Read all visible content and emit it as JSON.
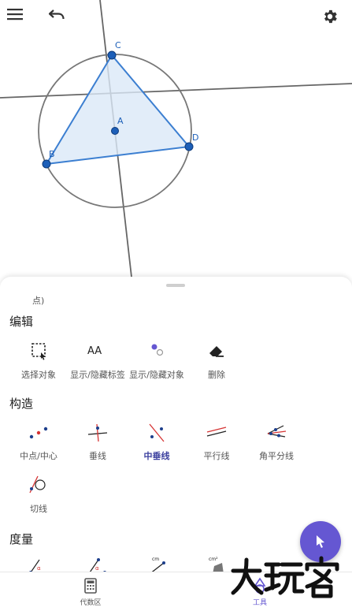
{
  "graph": {
    "point_labels": {
      "A": "A",
      "B": "B",
      "C": "C",
      "D": "D"
    }
  },
  "sheet": {
    "partial_label": "点)",
    "sections": {
      "edit": {
        "title": "编辑",
        "tools": [
          "选择对象",
          "显示/隐藏标签",
          "显示/隐藏对象",
          "删除"
        ]
      },
      "construct": {
        "title": "构造",
        "tools": [
          "中点/中心",
          "垂线",
          "中垂线",
          "平行线",
          "角平分线",
          "切线"
        ]
      },
      "measure": {
        "title": "度量",
        "icon_texts": {
          "angle_a": "α",
          "angle_b": "α",
          "cm": "cm",
          "cm2": "cm²"
        }
      }
    },
    "icon_texts": {
      "aa": "AA"
    }
  },
  "nav": {
    "algebra": "代数区",
    "tools": "工具"
  },
  "colors": {
    "accent": "#6557d2",
    "segment": "#3c7fd1",
    "triangle_fill": "#dbe8f7",
    "point": "#1d5fb8",
    "line": "#666666"
  }
}
